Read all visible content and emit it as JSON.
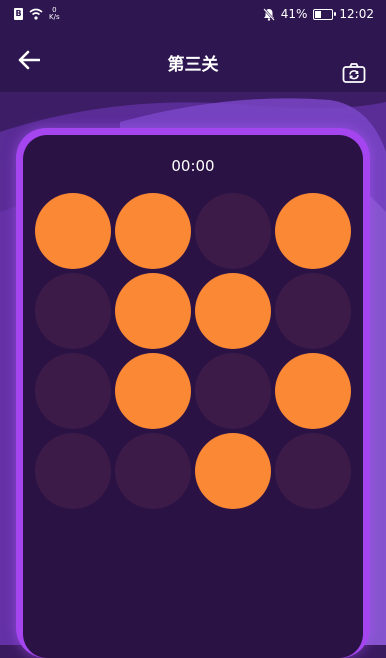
{
  "status_bar": {
    "sim_label": "B",
    "net_speed_value": "0",
    "net_speed_unit": "K/s",
    "battery": "41%",
    "battery_level": 0.41,
    "time": "12:02"
  },
  "header": {
    "title": "第三关",
    "back_icon": "arrow-left-icon",
    "camera_icon": "camera-rotate-icon"
  },
  "game": {
    "timer": "00:00",
    "rows": 4,
    "cols": 4,
    "cells": [
      [
        1,
        1,
        0,
        1
      ],
      [
        0,
        1,
        1,
        0
      ],
      [
        0,
        1,
        0,
        1
      ],
      [
        0,
        0,
        1,
        0
      ]
    ],
    "colors": {
      "on": "#fa8835",
      "off": "#3d1b48",
      "board": "#2a1244",
      "frame": "#a445f0"
    }
  }
}
